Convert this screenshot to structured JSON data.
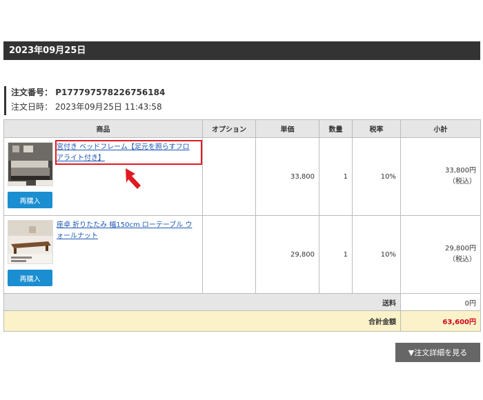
{
  "date_header": "2023年09月25日",
  "order": {
    "number_label": "注文番号：",
    "number": "P177797578226756184",
    "datetime_label": "注文日時：",
    "datetime": "2023年09月25日 11:43:58"
  },
  "table": {
    "headers": [
      "商品",
      "オプション",
      "単価",
      "数量",
      "税率",
      "小計"
    ],
    "items": [
      {
        "name": "宮付き ベッドフレーム【足元を照らすフロアライト付き】",
        "option": "",
        "price": "33,800",
        "qty": "1",
        "tax": "10%",
        "subtotal": "33,800円",
        "tax_note": "（税込）",
        "rebuy_label": "再購入",
        "image_icon": "bed-frame-thumbnail"
      },
      {
        "name": "座卓 折りたたみ 幅150cm ローテーブル ウォールナット",
        "option": "",
        "price": "29,800",
        "qty": "1",
        "tax": "10%",
        "subtotal": "29,800円",
        "tax_note": "（税込）",
        "rebuy_label": "再購入",
        "image_icon": "low-table-thumbnail"
      }
    ],
    "shipping_label": "送料",
    "shipping_value": "0円",
    "total_label": "合計金額",
    "total_value": "63,600円"
  },
  "details_button": "▼注文詳細を見る",
  "colors": {
    "header_bg": "#333333",
    "button_blue": "#1a8ed1",
    "link_blue": "#1a55b5",
    "highlight_red": "#e01a22",
    "total_bg": "#fbf2c9",
    "total_red": "#d0021b"
  }
}
